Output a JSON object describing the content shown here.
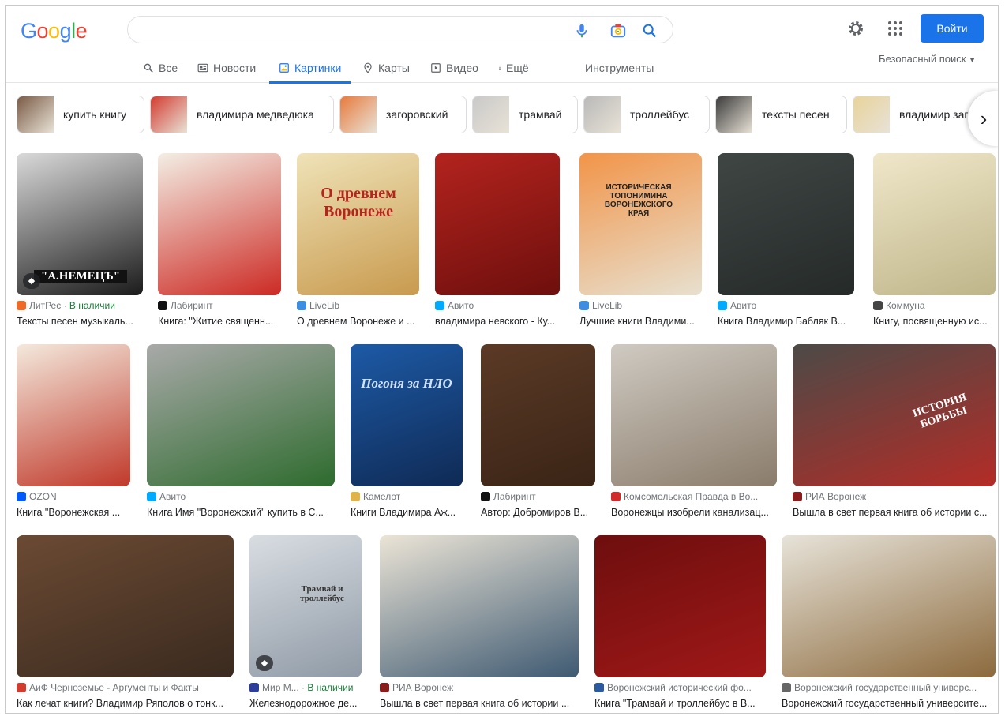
{
  "header": {
    "logo": [
      "G",
      "o",
      "o",
      "g",
      "l",
      "e"
    ],
    "logo_colors": [
      "#4285f4",
      "#ea4335",
      "#fbbc05",
      "#4285f4",
      "#34a853",
      "#ea4335"
    ],
    "search_value": "",
    "login_label": "Войти"
  },
  "tabs": [
    {
      "label": "Все",
      "icon": "search-icon"
    },
    {
      "label": "Новости",
      "icon": "news-icon"
    },
    {
      "label": "Картинки",
      "icon": "images-icon",
      "active": true
    },
    {
      "label": "Карты",
      "icon": "map-pin-icon"
    },
    {
      "label": "Видео",
      "icon": "video-icon"
    },
    {
      "label": "Ещё",
      "icon": "more-icon"
    }
  ],
  "tools_label": "Инструменты",
  "safesearch_label": "Безопасный поиск",
  "chips": [
    {
      "label": "купить книгу",
      "color": "#7a5b45"
    },
    {
      "label": "владимира медведюка",
      "color": "#d33b2f"
    },
    {
      "label": "загоровский",
      "color": "#e87a3c"
    },
    {
      "label": "трамвай",
      "color": "#c9c9c9"
    },
    {
      "label": "троллейбус",
      "color": "#b9b9b9"
    },
    {
      "label": "тексты песен",
      "color": "#3b3b3b"
    },
    {
      "label": "владимир загоровский",
      "color": "#e8d39a"
    }
  ],
  "results": [
    {
      "source": "ЛитРес",
      "available": "В наличии",
      "title": "Тексты песен музыкаль...",
      "fav": "#f06a25",
      "colors": [
        "#d9d9d9",
        "#1b1b1b"
      ],
      "cover": "\"А.НЕМЕЦЪ\""
    },
    {
      "source": "Лабиринт",
      "title": "Книга: \"Житие священн...",
      "fav": "#111111",
      "colors": [
        "#f3eee4",
        "#cc2a24"
      ],
      "cover": ""
    },
    {
      "source": "LiveLib",
      "title": "О древнем Воронеже и ...",
      "fav": "#3d8ee0",
      "colors": [
        "#efe3b8",
        "#c89a4e"
      ],
      "cover": "О древнем Воронеже"
    },
    {
      "source": "Авито",
      "title": "владимира невского - Ку...",
      "fav": "#00aaff",
      "colors": [
        "#b3231e",
        "#6e0f0d"
      ],
      "cover": ""
    },
    {
      "source": "LiveLib",
      "title": "Лучшие книги Владими...",
      "fav": "#3d8ee0",
      "colors": [
        "#f29448",
        "#e7e0cf"
      ],
      "cover": "ИСТОРИЧЕСКАЯ ТОПОНИМИНА ВОРОНЕЖСКОГО КРАЯ"
    },
    {
      "source": "Авито",
      "title": "Книга Владимир Бабляк В...",
      "fav": "#00aaff",
      "colors": [
        "#3f4644",
        "#252a29"
      ],
      "cover": ""
    },
    {
      "source": "Коммуна",
      "title": "Книгу, посвященную ис...",
      "fav": "#444444",
      "colors": [
        "#efe7c9",
        "#bfb58a"
      ],
      "cover": ""
    },
    {
      "source": "OZON",
      "title": "Книга \"Воронежская ...",
      "fav": "#005bff",
      "colors": [
        "#f3e9dc",
        "#c0392b"
      ],
      "cover": ""
    },
    {
      "source": "Авито",
      "title": "Книга Имя \"Воронежский\" купить в С...",
      "fav": "#00aaff",
      "colors": [
        "#a9a9a9",
        "#2e6b2e"
      ],
      "cover": ""
    },
    {
      "source": "Камелот",
      "title": "Книги Владимира Аж...",
      "fav": "#e0b24a",
      "colors": [
        "#1d5aa6",
        "#0f2a55"
      ],
      "cover": "Погоня за НЛО"
    },
    {
      "source": "Лабиринт",
      "title": "Автор: Добромиров В...",
      "fav": "#111111",
      "colors": [
        "#5b3a26",
        "#3a2416"
      ],
      "cover": ""
    },
    {
      "source": "Комсомольская Правда в Во...",
      "title": "Воронежцы изобрели канализац...",
      "fav": "#cf2b2b",
      "colors": [
        "#cfcac2",
        "#8a7c6b"
      ],
      "cover": ""
    },
    {
      "source": "РИА Воронеж",
      "title": "Вышла в свет первая книга об истории с...",
      "fav": "#8a1c1c",
      "colors": [
        "#4c4a47",
        "#b32c27"
      ],
      "cover": "ИСТОРИЯ БОРЬБЫ"
    },
    {
      "source": "АиФ Черноземье - Аргументы и Факты",
      "title": "Как лечат книги? Владимир Ряполов о тонк...",
      "fav": "#d33b2f",
      "colors": [
        "#6b4a33",
        "#3a2a1f"
      ],
      "cover": ""
    },
    {
      "source": "Мир М...",
      "available": "В наличии",
      "title": "Железнодорожное де...",
      "fav": "#2c3e99",
      "colors": [
        "#d9dde2",
        "#8f9aa6"
      ],
      "cover": "Трамвай и троллейбус"
    },
    {
      "source": "РИА Воронеж",
      "title": "Вышла в свет первая книга об истории ...",
      "fav": "#8a1c1c",
      "colors": [
        "#ebe4d6",
        "#3f5a72"
      ],
      "cover": ""
    },
    {
      "source": "Воронежский исторический фо...",
      "title": "Книга \"Трамвай и троллейбус в В...",
      "fav": "#2c5aa0",
      "colors": [
        "#6e0e0e",
        "#a01818"
      ],
      "cover": ""
    },
    {
      "source": "Воронежский государственный универс...",
      "title": "Воронежский государственный университе...",
      "fav": "#666666",
      "colors": [
        "#e7e3d9",
        "#8c6a3d"
      ],
      "cover": ""
    }
  ]
}
